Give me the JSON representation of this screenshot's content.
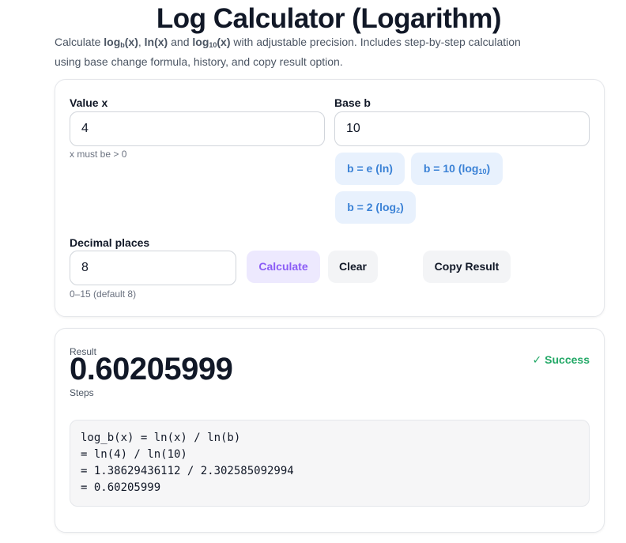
{
  "header": {
    "title": "Log Calculator (Logarithm)",
    "desc_pre": "Calculate ",
    "logb_main": "log",
    "logb_sub": "b",
    "logb_arg": "(x)",
    "comma1": ", ",
    "ln": "ln(x)",
    "and": " and ",
    "log10_main": "log",
    "log10_sub": "10",
    "log10_arg": "(x)",
    "desc_post": " with adjustable precision. Includes step-by-step calculation using base change formula, history, and copy result option."
  },
  "form": {
    "value_label": "Value x",
    "value": "4",
    "value_hint": "x must be > 0",
    "base_label": "Base b",
    "base": "10",
    "presets": {
      "e": {
        "text": "b = e (ln)"
      },
      "ten": {
        "main": "b = 10 (log",
        "sub": "10",
        "close": ")"
      },
      "two": {
        "main": "b = 2 (log",
        "sub": "2",
        "close": ")"
      }
    },
    "decimals_label": "Decimal places",
    "decimals": "8",
    "decimals_hint": "0–15 (default 8)",
    "calculate_label": "Calculate",
    "clear_label": "Clear",
    "copy_label": "Copy Result"
  },
  "output": {
    "result_label": "Result",
    "result_value": "0.60205999",
    "status": "✓ Success",
    "steps_label": "Steps",
    "steps": [
      "log_b(x) = ln(x) / ln(b)",
      "= ln(4) / ln(10)",
      "= 1.38629436112 / 2.302585092994",
      "= 0.60205999"
    ]
  },
  "colors": {
    "accent_blue": "#3b82d6",
    "accent_purple": "#8b5cf6",
    "success": "#22a866"
  }
}
